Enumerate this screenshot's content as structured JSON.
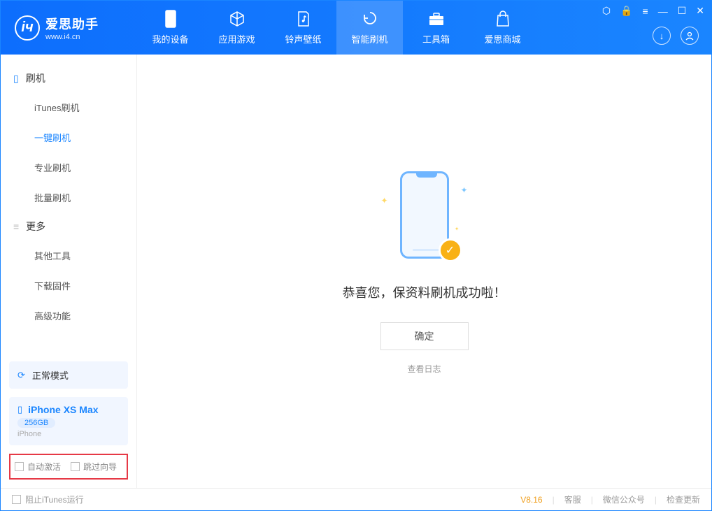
{
  "app": {
    "title": "爱思助手",
    "url": "www.i4.cn"
  },
  "nav": {
    "tabs": [
      {
        "label": "我的设备"
      },
      {
        "label": "应用游戏"
      },
      {
        "label": "铃声壁纸"
      },
      {
        "label": "智能刷机"
      },
      {
        "label": "工具箱"
      },
      {
        "label": "爱思商城"
      }
    ]
  },
  "sidebar": {
    "group1": {
      "title": "刷机"
    },
    "items1": [
      {
        "label": "iTunes刷机"
      },
      {
        "label": "一键刷机"
      },
      {
        "label": "专业刷机"
      },
      {
        "label": "批量刷机"
      }
    ],
    "group2": {
      "title": "更多"
    },
    "items2": [
      {
        "label": "其他工具"
      },
      {
        "label": "下载固件"
      },
      {
        "label": "高级功能"
      }
    ],
    "mode": {
      "label": "正常模式"
    },
    "device": {
      "name": "iPhone XS Max",
      "capacity": "256GB",
      "type": "iPhone"
    },
    "checks": {
      "auto_activate": "自动激活",
      "skip_guide": "跳过向导"
    }
  },
  "main": {
    "success_text": "恭喜您，保资料刷机成功啦！",
    "ok_label": "确定",
    "view_log": "查看日志"
  },
  "statusbar": {
    "block_itunes": "阻止iTunes运行",
    "version": "V8.16",
    "support": "客服",
    "wechat": "微信公众号",
    "update": "检查更新"
  }
}
